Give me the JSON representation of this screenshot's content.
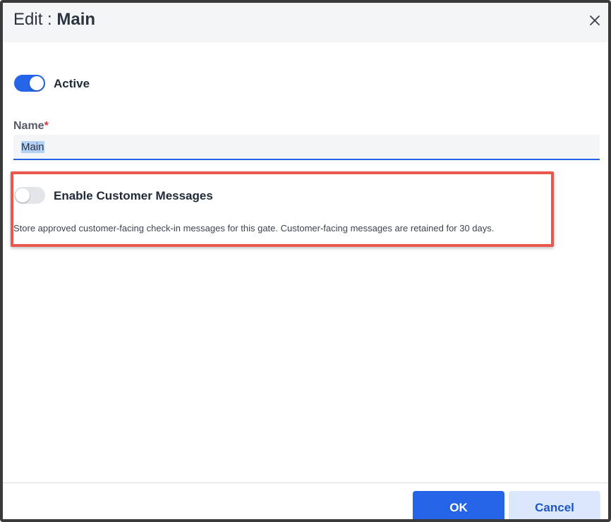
{
  "dialog": {
    "title_prefix": "Edit",
    "title_separator": ":",
    "title_name": "Main",
    "close_icon": "close-icon"
  },
  "form": {
    "active": {
      "label": "Active",
      "enabled": true
    },
    "name": {
      "label": "Name",
      "required_marker": "*",
      "value": "Main"
    },
    "customer_messages": {
      "label": "Enable Customer Messages",
      "enabled": false,
      "description": "Store approved customer-facing check-in messages for this gate. Customer-facing messages are retained for 30 days."
    }
  },
  "footer": {
    "ok_label": "OK",
    "cancel_label": "Cancel"
  },
  "colors": {
    "accent": "#2564e6",
    "highlight_border": "#e9574d",
    "required": "#e0383e",
    "header_bg": "#f4f5f7"
  }
}
